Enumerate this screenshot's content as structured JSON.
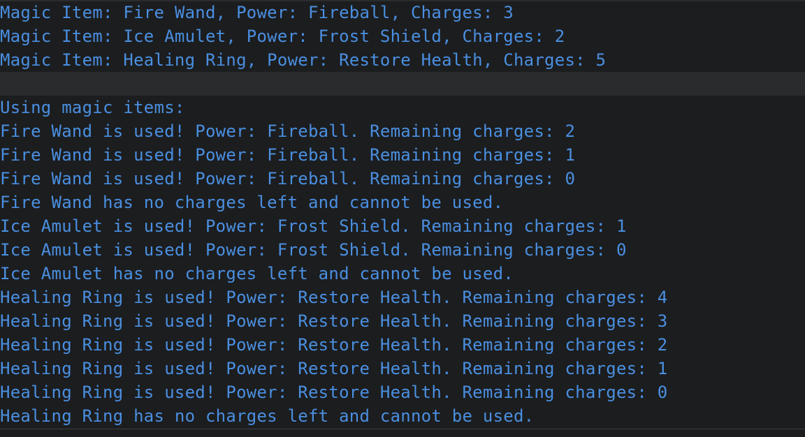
{
  "terminal": {
    "colors": {
      "background": "#1c1d1f",
      "text": "#4a8fe0",
      "highlight_row": "#2a2b2d"
    },
    "inventory_lines": [
      "Magic Item: Fire Wand, Power: Fireball, Charges: 3",
      "Magic Item: Ice Amulet, Power: Frost Shield, Charges: 2",
      "Magic Item: Healing Ring, Power: Restore Health, Charges: 5"
    ],
    "usage_header": "Using magic items:",
    "usage_lines": [
      "Fire Wand is used! Power: Fireball. Remaining charges: 2",
      "Fire Wand is used! Power: Fireball. Remaining charges: 1",
      "Fire Wand is used! Power: Fireball. Remaining charges: 0",
      "Fire Wand has no charges left and cannot be used.",
      "Ice Amulet is used! Power: Frost Shield. Remaining charges: 1",
      "Ice Amulet is used! Power: Frost Shield. Remaining charges: 0",
      "Ice Amulet has no charges left and cannot be used.",
      "Healing Ring is used! Power: Restore Health. Remaining charges: 4",
      "Healing Ring is used! Power: Restore Health. Remaining charges: 3",
      "Healing Ring is used! Power: Restore Health. Remaining charges: 2",
      "Healing Ring is used! Power: Restore Health. Remaining charges: 1",
      "Healing Ring is used! Power: Restore Health. Remaining charges: 0",
      "Healing Ring has no charges left and cannot be used."
    ]
  }
}
